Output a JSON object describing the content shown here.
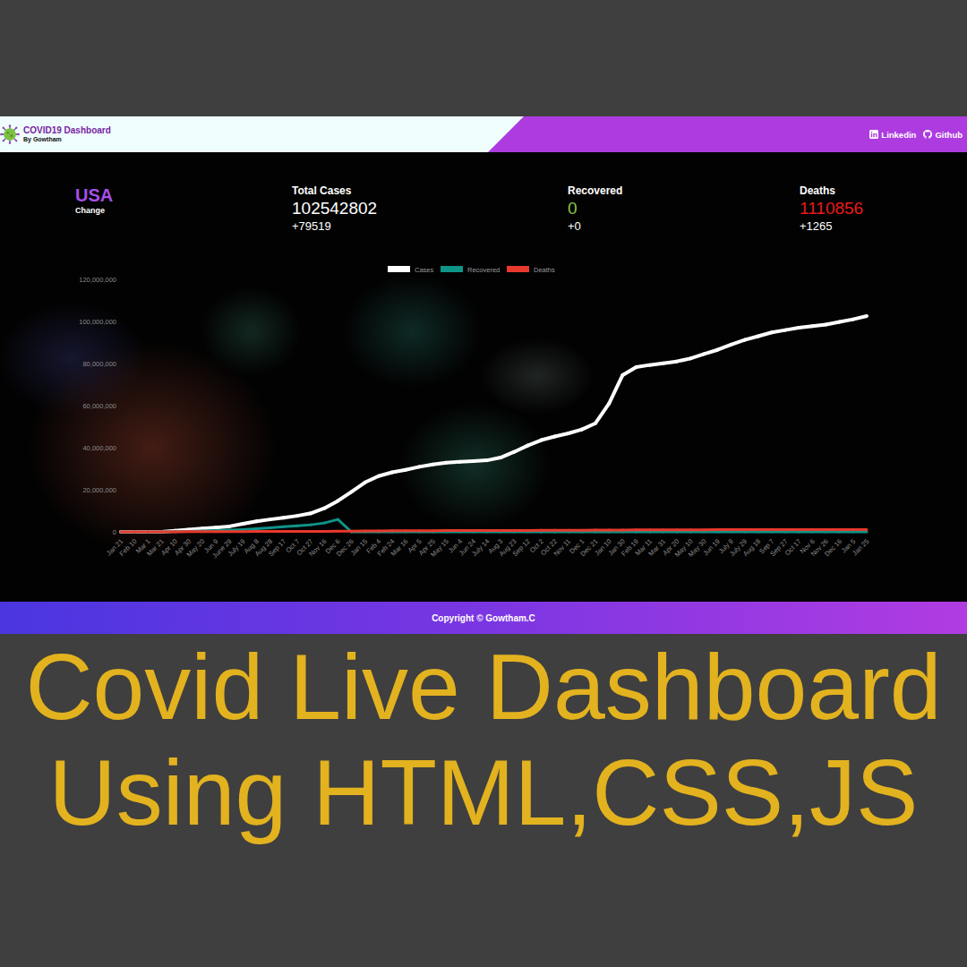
{
  "header": {
    "title": "COVID19 Dashboard",
    "subtitle": "By Gowtham",
    "links": [
      {
        "label": "Linkedin",
        "kind": "linkedin"
      },
      {
        "label": "Github",
        "kind": "github"
      }
    ]
  },
  "summary": {
    "country": "USA",
    "change_label": "Change",
    "stats": [
      {
        "label": "Total Cases",
        "value": "102542802",
        "delta": "+79519",
        "color": "#ffffff"
      },
      {
        "label": "Recovered",
        "value": "0",
        "delta": "+0",
        "color": "#8bc34a"
      },
      {
        "label": "Deaths",
        "value": "1110856",
        "delta": "+1265",
        "color": "#e8191c"
      }
    ]
  },
  "chart": {
    "y_ticks": [
      "0",
      "20,000,000",
      "40,000,000",
      "60,000,000",
      "80,000,000",
      "100,000,000",
      "120,000,000"
    ],
    "x_labels": [
      "Jan 21",
      "Feb 10",
      "Mar 1",
      "Mar 21",
      "Apr 10",
      "Apr 30",
      "May 20",
      "Jun 9",
      "June 29",
      "July 19",
      "Aug 8",
      "Aug 28",
      "Sep 17",
      "Oct 7",
      "Oct 27",
      "Nov 16",
      "Dec 6",
      "Dec 26",
      "Jan 15",
      "Feb 4",
      "Feb 24",
      "Mar 16",
      "Apr 5",
      "Apr 25",
      "May 15",
      "Jun 4",
      "Jun 24",
      "July 14",
      "Aug 3",
      "Aug 23",
      "Sep 12",
      "Oct 2",
      "Oct 22",
      "Nov 11",
      "Dec 1",
      "Dec 21",
      "Jan 10",
      "Jan 30",
      "Feb 19",
      "Mar 11",
      "Mar 31",
      "Apr 20",
      "May 10",
      "May 30",
      "Jun 19",
      "July 9",
      "July 29",
      "Aug 18",
      "Sep 7",
      "Sep 27",
      "Oct 17",
      "Nov 6",
      "Nov 26",
      "Dec 16",
      "Jan 5",
      "Jan 25"
    ],
    "series": [
      {
        "name": "Cases",
        "color": "#ffffff",
        "values": [
          1,
          12,
          75,
          24000,
          500000,
          1100000,
          1600000,
          2000000,
          2600000,
          3800000,
          5000000,
          5900000,
          6700000,
          7600000,
          8800000,
          11200000,
          14700000,
          19000000,
          23500000,
          26500000,
          28300000,
          29500000,
          30900000,
          32000000,
          32900000,
          33300000,
          33600000,
          34000000,
          35300000,
          38000000,
          41000000,
          43600000,
          45300000,
          46800000,
          48700000,
          51600000,
          61000000,
          74500000,
          78300000,
          79300000,
          80100000,
          81000000,
          82400000,
          84500000,
          86500000,
          89000000,
          91200000,
          93000000,
          94800000,
          95900000,
          97000000,
          97800000,
          98500000,
          99800000,
          101000000,
          102542802
        ]
      },
      {
        "name": "Recovered",
        "color": "#0f9488",
        "values": [
          0,
          0,
          0,
          0,
          100000,
          250000,
          450000,
          650000,
          850000,
          1100000,
          1500000,
          1950000,
          2400000,
          2850000,
          3350000,
          4200000,
          5900000,
          0,
          0,
          0,
          0,
          0,
          0,
          0,
          0,
          0,
          0,
          0,
          0,
          0,
          0,
          0,
          0,
          0,
          0,
          0,
          0,
          0,
          0,
          0,
          0,
          0,
          0,
          0,
          0,
          0,
          0,
          0,
          0,
          0,
          0,
          0,
          0,
          0,
          0,
          0
        ]
      },
      {
        "name": "Deaths",
        "color": "#e8392c",
        "values": [
          0,
          0,
          2,
          500,
          20000,
          65000,
          95000,
          113000,
          128000,
          143000,
          163000,
          183000,
          200000,
          214000,
          228000,
          250000,
          285000,
          335000,
          400000,
          450000,
          500000,
          540000,
          565000,
          580000,
          595000,
          605000,
          610000,
          615000,
          625000,
          640000,
          670000,
          710000,
          735000,
          760000,
          790000,
          810000,
          840000,
          890000,
          930000,
          965000,
          980000,
          990000,
          1000000,
          1010000,
          1015000,
          1025000,
          1035000,
          1045000,
          1060000,
          1070000,
          1080000,
          1085000,
          1090000,
          1097000,
          1104000,
          1110856
        ]
      }
    ]
  },
  "footer": {
    "copyright": "Copyright © Gowtham.C"
  },
  "caption": {
    "lines": [
      "Covid Live Dashboard",
      "Using HTML,CSS,JS"
    ]
  }
}
